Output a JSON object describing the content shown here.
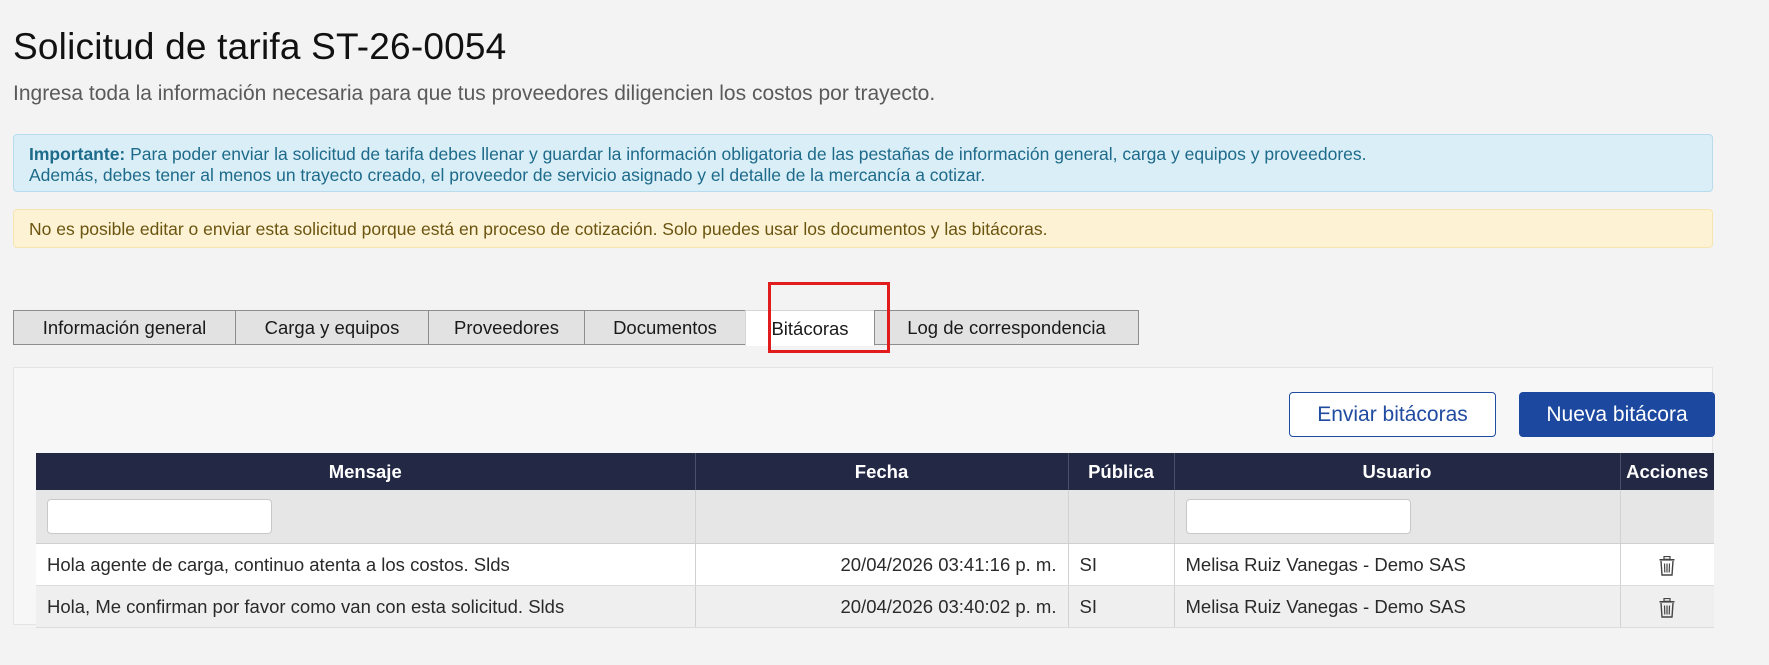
{
  "page": {
    "title": "Solicitud de tarifa ST-26-0054",
    "subtitle": "Ingresa toda la información necesaria para que tus proveedores diligencien los costos por trayecto."
  },
  "alerts": {
    "info_strong": "Importante:",
    "info_line1": " Para poder enviar la solicitud de tarifa debes llenar y guardar la información obligatoria de las pestañas de información general, carga y equipos y proveedores.",
    "info_line2": "Además, debes tener al menos un trayecto creado, el proveedor de servicio asignado y el detalle de la mercancía a cotizar.",
    "warning": "No es posible editar o enviar esta solicitud porque está en proceso de cotización. Solo puedes usar los documentos y las bitácoras."
  },
  "tabs": [
    {
      "label": "Información general"
    },
    {
      "label": "Carga y equipos"
    },
    {
      "label": "Proveedores"
    },
    {
      "label": "Documentos"
    },
    {
      "label": "Bitácoras",
      "active": true
    },
    {
      "label": "Log de correspondencia"
    }
  ],
  "actions": {
    "send_label": "Enviar bitácoras",
    "new_label": "Nueva bitácora"
  },
  "table": {
    "columns": [
      "Mensaje",
      "Fecha",
      "Pública",
      "Usuario",
      "Acciones"
    ],
    "filters": {
      "mensaje": "",
      "usuario": ""
    },
    "rows": [
      {
        "mensaje": "Hola agente de carga, continuo atenta a los costos. Slds",
        "fecha": "20/04/2026 03:41:16 p. m.",
        "publica": "SI",
        "usuario": "Melisa Ruiz Vanegas - Demo SAS",
        "accion_icon": "trash-icon"
      },
      {
        "mensaje": "Hola, Me confirman por favor como van con esta solicitud. Slds",
        "fecha": "20/04/2026 03:40:02 p. m.",
        "publica": "SI",
        "usuario": "Melisa Ruiz Vanegas - Demo SAS",
        "accion_icon": "trash-icon"
      }
    ]
  },
  "colors": {
    "primary": "#1c48a0",
    "table_header": "#232845",
    "highlight": "#e01c1c",
    "info_bg": "#d9eef7",
    "warning_bg": "#fdf3d4"
  }
}
